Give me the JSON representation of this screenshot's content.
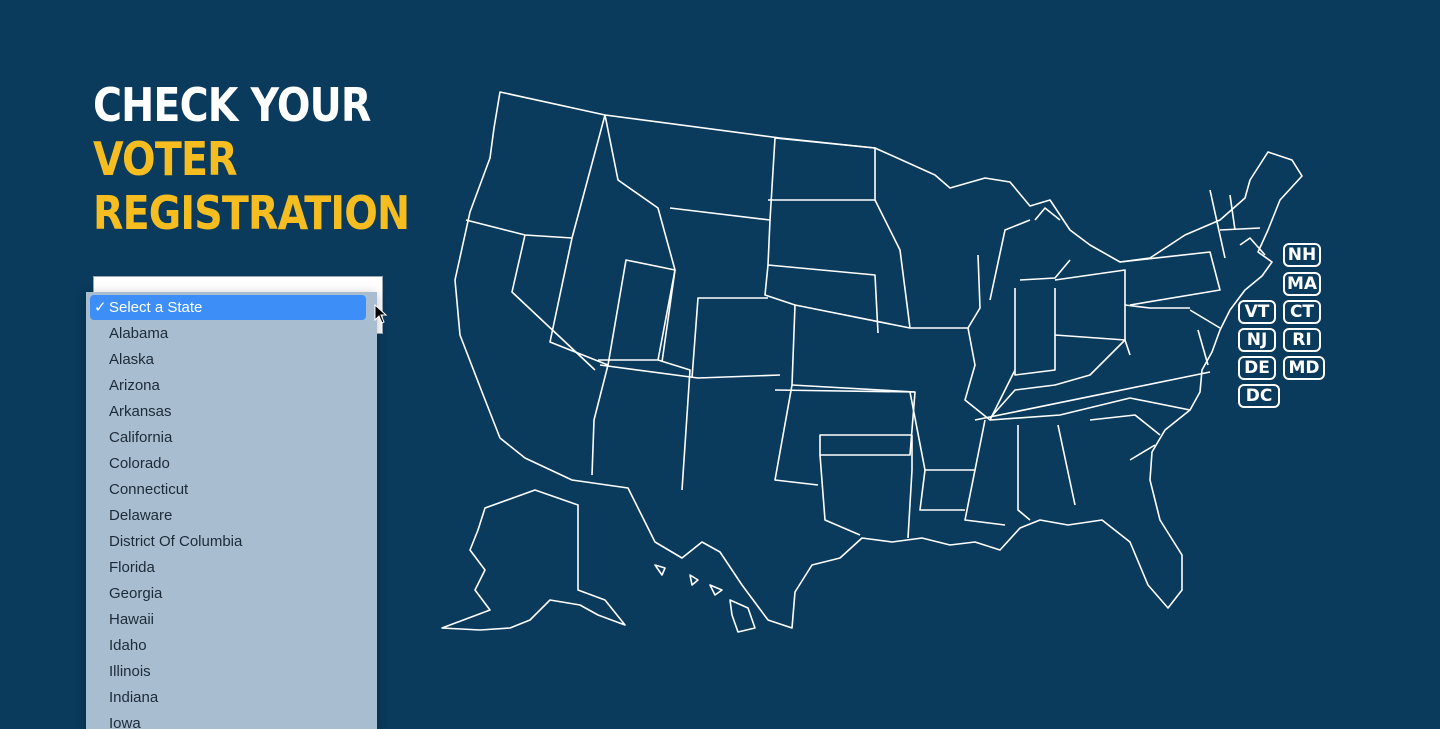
{
  "heading": {
    "line1": "Check your",
    "line2": "Voter",
    "line3": "Registration"
  },
  "state_select": {
    "selected": "Select a State",
    "check_mark": "✓",
    "options": [
      "Alabama",
      "Alaska",
      "Arizona",
      "Arkansas",
      "California",
      "Colorado",
      "Connecticut",
      "Delaware",
      "District Of Columbia",
      "Florida",
      "Georgia",
      "Hawaii",
      "Idaho",
      "Illinois",
      "Indiana",
      "Iowa"
    ]
  },
  "small_states": {
    "nh": "NH",
    "ma": "MA",
    "vt": "VT",
    "ct": "CT",
    "nj": "NJ",
    "ri": "RI",
    "de": "DE",
    "md": "MD",
    "dc": "DC"
  },
  "colors": {
    "background": "#0a3a5c",
    "accent": "#f5bd1f",
    "selected": "#3d8ff7"
  }
}
